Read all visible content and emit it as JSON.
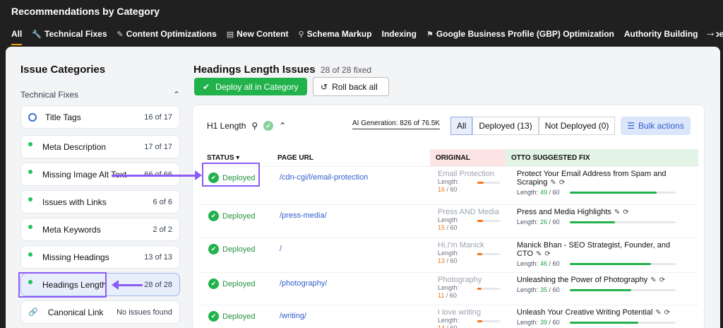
{
  "header": {
    "title": "Recommendations by Category",
    "tabs": [
      {
        "label": "All",
        "icon": ""
      },
      {
        "label": "Technical Fixes",
        "icon": "wrench-icon"
      },
      {
        "label": "Content Optimizations",
        "icon": "edit-icon"
      },
      {
        "label": "New Content",
        "icon": "document-icon"
      },
      {
        "label": "Schema Markup",
        "icon": "search-icon"
      },
      {
        "label": "Indexing",
        "icon": ""
      },
      {
        "label": "Google Business Profile (GBP) Optimization",
        "icon": "map-pin-icon"
      },
      {
        "label": "Authority Building (Hype",
        "icon": ""
      }
    ]
  },
  "sidebar": {
    "title": "Issue Categories",
    "group_label": "Technical Fixes",
    "items": [
      {
        "label": "Title Tags",
        "count": "16 of 17"
      },
      {
        "label": "Meta Description",
        "count": "17 of 17"
      },
      {
        "label": "Missing Image Alt Text",
        "count": "66 of 66"
      },
      {
        "label": "Issues with Links",
        "count": "6 of 6"
      },
      {
        "label": "Meta Keywords",
        "count": "2 of 2"
      },
      {
        "label": "Missing Headings",
        "count": "13 of 13"
      },
      {
        "label": "Headings Length",
        "count": "28 of 28"
      },
      {
        "label": "Canonical Link",
        "count": "No issues found"
      }
    ]
  },
  "main": {
    "title": "Headings Length Issues",
    "fixed_count": "28 of 28 fixed",
    "deploy_all_label": "Deploy all in Category",
    "rollback_label": "Roll back all",
    "filter_label": "H1 Length",
    "ai_generation": "AI Generation: 826 of 76.5K",
    "segments": {
      "all": "All",
      "deployed": "Deployed (13)",
      "not_deployed": "Not Deployed (0)"
    },
    "bulk_actions": "Bulk actions",
    "columns": {
      "status": "STATUS",
      "page_url": "PAGE URL",
      "original": "ORIGINAL",
      "suggested": "OTTO SUGGESTED FIX"
    },
    "length_label": "Length:",
    "max_length": "60",
    "rows": [
      {
        "status": "Deployed",
        "url": "/cdn-cgi/l/email-protection",
        "original": "Email Protection",
        "orig_len": "16",
        "orig_frac": 0.27,
        "fix": "Protect Your Email Address from Spam and Scraping",
        "fix_len": "49",
        "fix_frac": 0.82
      },
      {
        "status": "Deployed",
        "url": "/press-media/",
        "original": "Press AND Media",
        "orig_len": "15",
        "orig_frac": 0.25,
        "fix": "Press and Media Highlights",
        "fix_len": "26",
        "fix_frac": 0.43
      },
      {
        "status": "Deployed",
        "url": "/",
        "original": "Hi,I'm Manick",
        "orig_len": "13",
        "orig_frac": 0.22,
        "fix": "Manick Bhan - SEO Strategist, Founder, and CTO",
        "fix_len": "46",
        "fix_frac": 0.77
      },
      {
        "status": "Deployed",
        "url": "/photography/",
        "original": "Photography",
        "orig_len": "11",
        "orig_frac": 0.18,
        "fix": "Unleashing the Power of Photography",
        "fix_len": "35",
        "fix_frac": 0.58
      },
      {
        "status": "Deployed",
        "url": "/writing/",
        "original": "I love writing",
        "orig_len": "14",
        "orig_frac": 0.23,
        "fix": "Unleash Your Creative Writing Potential",
        "fix_len": "39",
        "fix_frac": 0.65
      }
    ]
  }
}
